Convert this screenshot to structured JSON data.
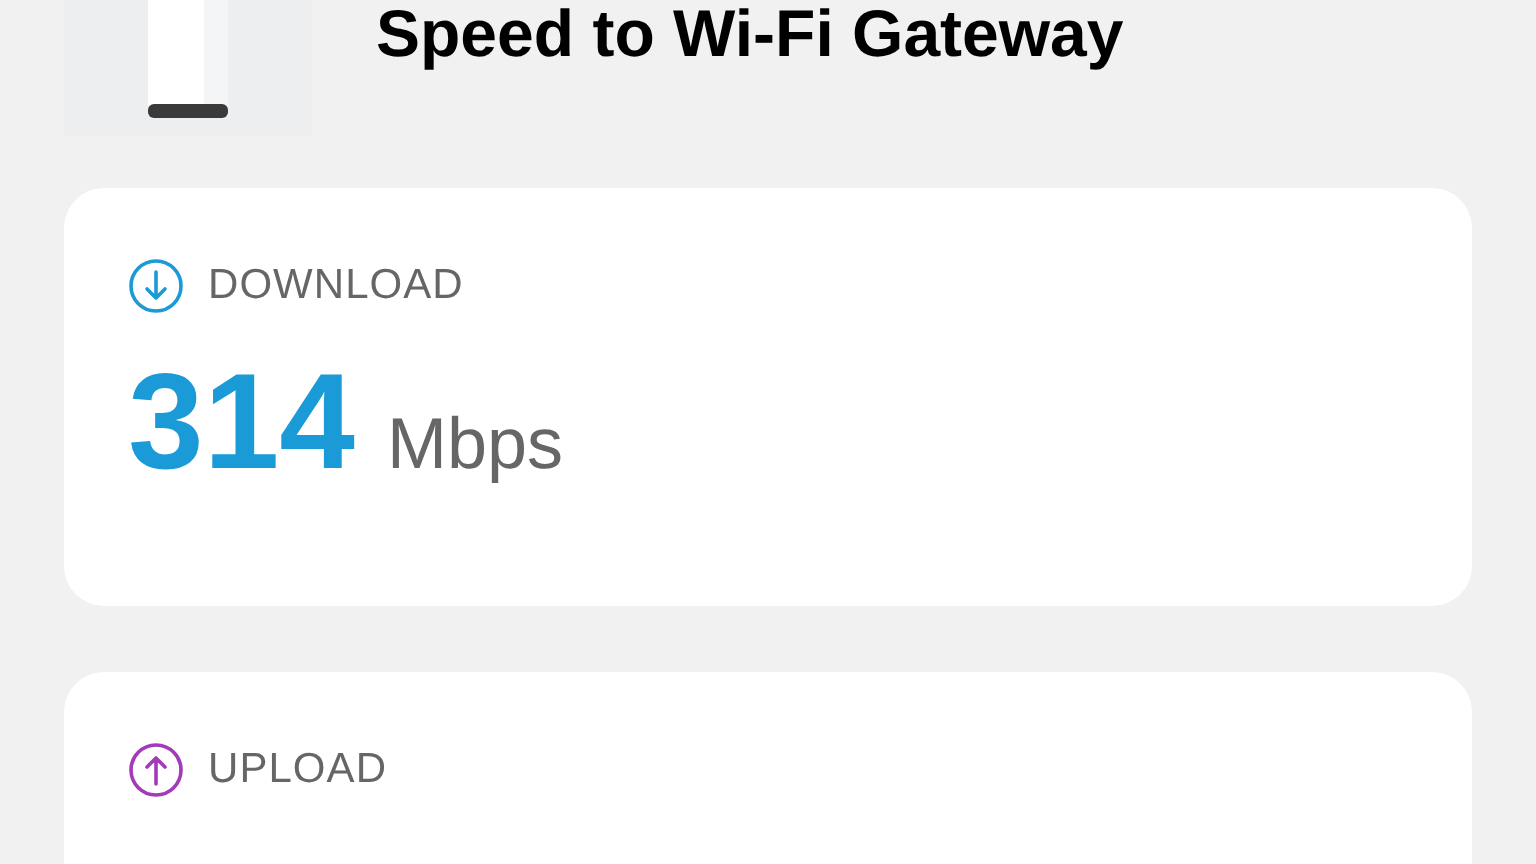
{
  "header": {
    "title": "Speed to Wi-Fi Gateway"
  },
  "results": [
    {
      "kind": "download",
      "label": "DOWNLOAD",
      "color": "#1a9ad6",
      "value": "314",
      "unit": "Mbps"
    },
    {
      "kind": "upload",
      "label": "UPLOAD",
      "color": "#a33ab8"
    }
  ]
}
